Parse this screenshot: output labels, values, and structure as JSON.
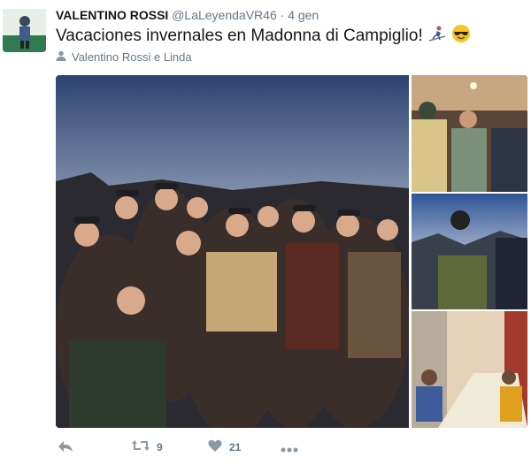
{
  "tweet": {
    "author_name": "VALENTINO ROSSI",
    "handle": "@LaLeyendaVR46",
    "separator": "·",
    "time": "4 gen",
    "text": "Vacaciones invernales en Madonna di Campiglio!",
    "tagged": "Valentino Rossi e Linda"
  },
  "actions": {
    "retweet_count": "9",
    "like_count": "21"
  },
  "icons": [
    "reply-icon",
    "retweet-icon",
    "like-icon",
    "more-icon",
    "person-icon",
    "skier-emoji-icon",
    "sunglasses-emoji-icon"
  ],
  "colors": {
    "muted": "#8899a6",
    "text": "#14171a",
    "secondary": "#657786"
  }
}
